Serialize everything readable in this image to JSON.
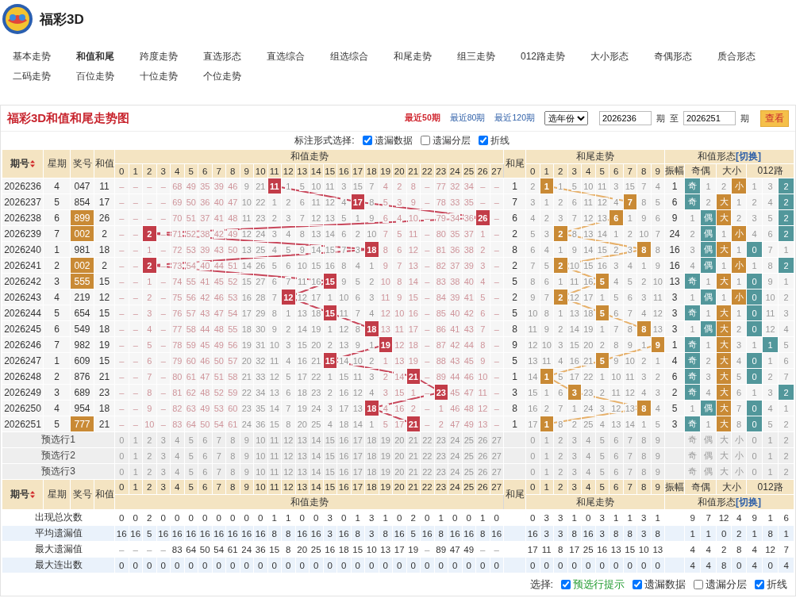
{
  "header": {
    "title": "福彩3D"
  },
  "nav": [
    {
      "label": "基本走势",
      "selected": false
    },
    {
      "label": "和值和尾",
      "selected": true
    },
    {
      "label": "跨度走势",
      "selected": false
    },
    {
      "label": "直选形态",
      "selected": false
    },
    {
      "label": "直选综合",
      "selected": false
    },
    {
      "label": "组选综合",
      "selected": false
    },
    {
      "label": "和尾走势",
      "selected": false
    },
    {
      "label": "组三走势",
      "selected": false
    },
    {
      "label": "012路走势",
      "selected": false
    },
    {
      "label": "大小形态",
      "selected": false
    },
    {
      "label": "奇偶形态",
      "selected": false
    },
    {
      "label": "质合形态",
      "selected": false
    },
    {
      "label": "二码走势",
      "selected": false
    },
    {
      "label": "百位走势",
      "selected": false
    },
    {
      "label": "十位走势",
      "selected": false
    },
    {
      "label": "个位走势",
      "selected": false
    }
  ],
  "panel": {
    "title": "福彩3D和值和尾走势图",
    "range_links": [
      {
        "label": "最近50期",
        "selected": true
      },
      {
        "label": "最近80期",
        "selected": false
      },
      {
        "label": "最近120期",
        "selected": false
      }
    ],
    "year_select": "选年份",
    "from": "2026236",
    "from_unit": "期",
    "to_label": "至",
    "to": "2026251",
    "to_unit": "期",
    "view_button": "查看"
  },
  "marking": {
    "label": "标注形式选择:",
    "options": [
      {
        "label": "遗漏数据",
        "checked": true
      },
      {
        "label": "遗漏分层",
        "checked": false
      },
      {
        "label": "折线",
        "checked": true
      }
    ]
  },
  "table": {
    "head": {
      "issue": "期号",
      "weekday": "星期",
      "draw": "奖号",
      "sum": "和值",
      "sum_trend": "和值走势",
      "sum_cols": [
        "0",
        "1",
        "2",
        "3",
        "4",
        "5",
        "6",
        "7",
        "8",
        "9",
        "10",
        "11",
        "12",
        "13",
        "14",
        "15",
        "16",
        "17",
        "18",
        "19",
        "20",
        "21",
        "22",
        "23",
        "24",
        "25",
        "26",
        "27"
      ],
      "tail": "和尾",
      "tail_trend": "和尾走势",
      "tail_cols": [
        "0",
        "1",
        "2",
        "3",
        "4",
        "5",
        "6",
        "7",
        "8",
        "9"
      ],
      "form": "和值形态",
      "switch": "[切换]",
      "amplitude": "振幅",
      "odd_even": "奇偶",
      "size": "大小",
      "mod3": "012路"
    },
    "rows": [
      {
        "issue": "2026236",
        "weekday": "4",
        "draw": "047",
        "draw_marked": false,
        "sum": "11",
        "sum_cells": [
          "–",
          "–",
          "–",
          "–",
          "68",
          "49",
          "35",
          "39",
          "46",
          "9",
          "21",
          {
            "text": "11",
            "hit": true
          },
          "1",
          "5",
          "10",
          "11",
          "3",
          "15",
          "7",
          "4",
          "2",
          "8",
          "–",
          "77",
          "32",
          "34",
          "–",
          "–"
        ],
        "tail": "1",
        "tail_cells": [
          "2",
          {
            "text": "1",
            "hit": true
          },
          "1",
          "5",
          "10",
          "11",
          "3",
          "15",
          "7",
          "4"
        ],
        "amplitude": "1",
        "form_cells": [
          {
            "text": "奇",
            "hit": true
          },
          "1",
          "2",
          {
            "text": "小",
            "hit": true
          },
          "1",
          "3",
          {
            "text": "2",
            "hit": true
          }
        ]
      },
      {
        "issue": "2026237",
        "weekday": "5",
        "draw": "854",
        "draw_marked": false,
        "sum": "17",
        "sum_cells": [
          "–",
          "–",
          "–",
          "–",
          "69",
          "50",
          "36",
          "40",
          "47",
          "10",
          "22",
          "1",
          "2",
          "6",
          "11",
          "12",
          "4",
          {
            "text": "17",
            "hit": true
          },
          "8",
          "5",
          "3",
          "9",
          "–",
          "78",
          "33",
          "35",
          "–",
          "–"
        ],
        "tail": "7",
        "tail_cells": [
          "3",
          "1",
          "2",
          "6",
          "11",
          "12",
          "4",
          {
            "text": "7",
            "hit": true
          },
          "8",
          "5"
        ],
        "amplitude": "6",
        "form_cells": [
          {
            "text": "奇",
            "hit": true
          },
          "2",
          {
            "text": "大",
            "hit": true
          },
          "1",
          "2",
          "4",
          {
            "text": "2",
            "hit": true
          }
        ]
      },
      {
        "issue": "2026238",
        "weekday": "6",
        "draw": "899",
        "draw_marked": true,
        "sum": "26",
        "sum_cells": [
          "–",
          "–",
          "–",
          "–",
          "70",
          "51",
          "37",
          "41",
          "48",
          "11",
          "23",
          "2",
          "3",
          "7",
          "12",
          "13",
          "5",
          "1",
          "9",
          "6",
          "4",
          "10",
          "–",
          "79",
          "34",
          "36",
          {
            "text": "26",
            "hit": true
          },
          "–"
        ],
        "tail": "6",
        "tail_cells": [
          "4",
          "2",
          "3",
          "7",
          "12",
          "13",
          {
            "text": "6",
            "hit": true
          },
          "1",
          "9",
          "6"
        ],
        "amplitude": "9",
        "form_cells": [
          "1",
          {
            "text": "偶",
            "hit": true
          },
          {
            "text": "大",
            "hit": true
          },
          "2",
          "3",
          "5",
          {
            "text": "2",
            "hit": true
          }
        ]
      },
      {
        "issue": "2026239",
        "weekday": "7",
        "draw": "002",
        "draw_marked": true,
        "sum": "2",
        "sum_cells": [
          "–",
          "–",
          {
            "text": "2",
            "hit": true
          },
          "–",
          "71",
          "52",
          "38",
          "42",
          "49",
          "12",
          "24",
          "3",
          "4",
          "8",
          "13",
          "14",
          "6",
          "2",
          "10",
          "7",
          "5",
          "11",
          "–",
          "80",
          "35",
          "37",
          "1",
          "–"
        ],
        "tail": "2",
        "tail_cells": [
          "5",
          "3",
          {
            "text": "2",
            "hit": true
          },
          "8",
          "13",
          "14",
          "1",
          "2",
          "10",
          "7"
        ],
        "amplitude": "24",
        "form_cells": [
          "2",
          {
            "text": "偶",
            "hit": true
          },
          "1",
          {
            "text": "小",
            "hit": true
          },
          "4",
          "6",
          {
            "text": "2",
            "hit": true
          }
        ]
      },
      {
        "issue": "2026240",
        "weekday": "1",
        "draw": "981",
        "draw_marked": false,
        "sum": "18",
        "sum_cells": [
          "–",
          "–",
          "1",
          "–",
          "72",
          "53",
          "39",
          "43",
          "50",
          "13",
          "25",
          "4",
          "5",
          "9",
          "14",
          "15",
          "7",
          "3",
          {
            "text": "18",
            "hit": true
          },
          "8",
          "6",
          "12",
          "–",
          "81",
          "36",
          "38",
          "2",
          "–"
        ],
        "tail": "8",
        "tail_cells": [
          "6",
          "4",
          "1",
          "9",
          "14",
          "15",
          "2",
          "3",
          {
            "text": "8",
            "hit": true
          },
          "8"
        ],
        "amplitude": "16",
        "form_cells": [
          "3",
          {
            "text": "偶",
            "hit": true
          },
          {
            "text": "大",
            "hit": true
          },
          "1",
          {
            "text": "0",
            "hit": true
          },
          "7",
          "1"
        ]
      },
      {
        "issue": "2026241",
        "weekday": "2",
        "draw": "002",
        "draw_marked": true,
        "sum": "2",
        "sum_cells": [
          "–",
          "–",
          {
            "text": "2",
            "hit": true
          },
          "–",
          "73",
          "54",
          "40",
          "44",
          "51",
          "14",
          "26",
          "5",
          "6",
          "10",
          "15",
          "16",
          "8",
          "4",
          "1",
          "9",
          "7",
          "13",
          "–",
          "82",
          "37",
          "39",
          "3",
          "–"
        ],
        "tail": "2",
        "tail_cells": [
          "7",
          "5",
          {
            "text": "2",
            "hit": true
          },
          "10",
          "15",
          "16",
          "3",
          "4",
          "1",
          "9"
        ],
        "amplitude": "16",
        "form_cells": [
          "4",
          {
            "text": "偶",
            "hit": true
          },
          "1",
          {
            "text": "小",
            "hit": true
          },
          "1",
          "8",
          {
            "text": "2",
            "hit": true
          }
        ]
      },
      {
        "issue": "2026242",
        "weekday": "3",
        "draw": "555",
        "draw_marked": true,
        "sum": "15",
        "sum_cells": [
          "–",
          "–",
          "1",
          "–",
          "74",
          "55",
          "41",
          "45",
          "52",
          "15",
          "27",
          "6",
          "7",
          "11",
          "16",
          {
            "text": "15",
            "hit": true
          },
          "9",
          "5",
          "2",
          "10",
          "8",
          "14",
          "–",
          "83",
          "38",
          "40",
          "4",
          "–"
        ],
        "tail": "5",
        "tail_cells": [
          "8",
          "6",
          "1",
          "11",
          "16",
          {
            "text": "5",
            "hit": true
          },
          "4",
          "5",
          "2",
          "10"
        ],
        "amplitude": "13",
        "form_cells": [
          {
            "text": "奇",
            "hit": true
          },
          "1",
          {
            "text": "大",
            "hit": true
          },
          "1",
          {
            "text": "0",
            "hit": true
          },
          "9",
          "1"
        ]
      },
      {
        "issue": "2026243",
        "weekday": "4",
        "draw": "219",
        "draw_marked": false,
        "sum": "12",
        "sum_cells": [
          "–",
          "–",
          "2",
          "–",
          "75",
          "56",
          "42",
          "46",
          "53",
          "16",
          "28",
          "7",
          {
            "text": "12",
            "hit": true
          },
          "12",
          "17",
          "1",
          "10",
          "6",
          "3",
          "11",
          "9",
          "15",
          "–",
          "84",
          "39",
          "41",
          "5",
          "–"
        ],
        "tail": "2",
        "tail_cells": [
          "9",
          "7",
          {
            "text": "2",
            "hit": true
          },
          "12",
          "17",
          "1",
          "5",
          "6",
          "3",
          "11"
        ],
        "amplitude": "3",
        "form_cells": [
          "1",
          {
            "text": "偶",
            "hit": true
          },
          "1",
          {
            "text": "小",
            "hit": true
          },
          {
            "text": "0",
            "hit": true
          },
          "10",
          "2"
        ]
      },
      {
        "issue": "2026244",
        "weekday": "5",
        "draw": "654",
        "draw_marked": false,
        "sum": "15",
        "sum_cells": [
          "–",
          "–",
          "3",
          "–",
          "76",
          "57",
          "43",
          "47",
          "54",
          "17",
          "29",
          "8",
          "1",
          "13",
          "18",
          {
            "text": "15",
            "hit": true
          },
          "11",
          "7",
          "4",
          "12",
          "10",
          "16",
          "–",
          "85",
          "40",
          "42",
          "6",
          "–"
        ],
        "tail": "5",
        "tail_cells": [
          "10",
          "8",
          "1",
          "13",
          "18",
          {
            "text": "5",
            "hit": true
          },
          "6",
          "7",
          "4",
          "12"
        ],
        "amplitude": "3",
        "form_cells": [
          {
            "text": "奇",
            "hit": true
          },
          "1",
          {
            "text": "大",
            "hit": true
          },
          "1",
          {
            "text": "0",
            "hit": true
          },
          "11",
          "3"
        ]
      },
      {
        "issue": "2026245",
        "weekday": "6",
        "draw": "549",
        "draw_marked": false,
        "sum": "18",
        "sum_cells": [
          "–",
          "–",
          "4",
          "–",
          "77",
          "58",
          "44",
          "48",
          "55",
          "18",
          "30",
          "9",
          "2",
          "14",
          "19",
          "1",
          "12",
          "8",
          {
            "text": "18",
            "hit": true
          },
          "13",
          "11",
          "17",
          "–",
          "86",
          "41",
          "43",
          "7",
          "–"
        ],
        "tail": "8",
        "tail_cells": [
          "11",
          "9",
          "2",
          "14",
          "19",
          "1",
          "7",
          "8",
          {
            "text": "8",
            "hit": true
          },
          "13"
        ],
        "amplitude": "3",
        "form_cells": [
          "1",
          {
            "text": "偶",
            "hit": true
          },
          {
            "text": "大",
            "hit": true
          },
          "2",
          {
            "text": "0",
            "hit": true
          },
          "12",
          "4"
        ]
      },
      {
        "issue": "2026246",
        "weekday": "7",
        "draw": "982",
        "draw_marked": false,
        "sum": "19",
        "sum_cells": [
          "–",
          "–",
          "5",
          "–",
          "78",
          "59",
          "45",
          "49",
          "56",
          "19",
          "31",
          "10",
          "3",
          "15",
          "20",
          "2",
          "13",
          "9",
          "1",
          {
            "text": "19",
            "hit": true
          },
          "12",
          "18",
          "–",
          "87",
          "42",
          "44",
          "8",
          "–"
        ],
        "tail": "9",
        "tail_cells": [
          "12",
          "10",
          "3",
          "15",
          "20",
          "2",
          "8",
          "9",
          "1",
          {
            "text": "9",
            "hit": true
          }
        ],
        "amplitude": "1",
        "form_cells": [
          {
            "text": "奇",
            "hit": true
          },
          "1",
          {
            "text": "大",
            "hit": true
          },
          "3",
          "1",
          {
            "text": "1",
            "hit": true
          },
          "5"
        ]
      },
      {
        "issue": "2026247",
        "weekday": "1",
        "draw": "609",
        "draw_marked": false,
        "sum": "15",
        "sum_cells": [
          "–",
          "–",
          "6",
          "–",
          "79",
          "60",
          "46",
          "50",
          "57",
          "20",
          "32",
          "11",
          "4",
          "16",
          "21",
          {
            "text": "15",
            "hit": true
          },
          "14",
          "10",
          "2",
          "1",
          "13",
          "19",
          "–",
          "88",
          "43",
          "45",
          "9",
          "–"
        ],
        "tail": "5",
        "tail_cells": [
          "13",
          "11",
          "4",
          "16",
          "21",
          {
            "text": "5",
            "hit": true
          },
          "9",
          "10",
          "2",
          "1"
        ],
        "amplitude": "4",
        "form_cells": [
          {
            "text": "奇",
            "hit": true
          },
          "2",
          {
            "text": "大",
            "hit": true
          },
          "4",
          {
            "text": "0",
            "hit": true
          },
          "1",
          "6"
        ]
      },
      {
        "issue": "2026248",
        "weekday": "2",
        "draw": "876",
        "draw_marked": false,
        "sum": "21",
        "sum_cells": [
          "–",
          "–",
          "7",
          "–",
          "80",
          "61",
          "47",
          "51",
          "58",
          "21",
          "33",
          "12",
          "5",
          "17",
          "22",
          "1",
          "15",
          "11",
          "3",
          "2",
          "14",
          {
            "text": "21",
            "hit": true
          },
          "–",
          "89",
          "44",
          "46",
          "10",
          "–"
        ],
        "tail": "1",
        "tail_cells": [
          "14",
          {
            "text": "1",
            "hit": true
          },
          "5",
          "17",
          "22",
          "1",
          "10",
          "11",
          "3",
          "2"
        ],
        "amplitude": "6",
        "form_cells": [
          {
            "text": "奇",
            "hit": true
          },
          "3",
          {
            "text": "大",
            "hit": true
          },
          "5",
          {
            "text": "0",
            "hit": true
          },
          "2",
          "7"
        ]
      },
      {
        "issue": "2026249",
        "weekday": "3",
        "draw": "689",
        "draw_marked": false,
        "sum": "23",
        "sum_cells": [
          "–",
          "–",
          "8",
          "–",
          "81",
          "62",
          "48",
          "52",
          "59",
          "22",
          "34",
          "13",
          "6",
          "18",
          "23",
          "2",
          "16",
          "12",
          "4",
          "3",
          "15",
          "1",
          "–",
          {
            "text": "23",
            "hit": true
          },
          "45",
          "47",
          "11",
          "–"
        ],
        "tail": "3",
        "tail_cells": [
          "15",
          "1",
          "6",
          {
            "text": "3",
            "hit": true
          },
          "23",
          "2",
          "11",
          "12",
          "4",
          "3"
        ],
        "amplitude": "2",
        "form_cells": [
          {
            "text": "奇",
            "hit": true
          },
          "4",
          {
            "text": "大",
            "hit": true
          },
          "6",
          "1",
          "3",
          {
            "text": "2",
            "hit": true
          }
        ]
      },
      {
        "issue": "2026250",
        "weekday": "4",
        "draw": "954",
        "draw_marked": false,
        "sum": "18",
        "sum_cells": [
          "–",
          "–",
          "9",
          "–",
          "82",
          "63",
          "49",
          "53",
          "60",
          "23",
          "35",
          "14",
          "7",
          "19",
          "24",
          "3",
          "17",
          "13",
          {
            "text": "18",
            "hit": true
          },
          "4",
          "16",
          "2",
          "–",
          "1",
          "46",
          "48",
          "12",
          "–"
        ],
        "tail": "8",
        "tail_cells": [
          "16",
          "2",
          "7",
          "1",
          "24",
          "3",
          "12",
          "13",
          {
            "text": "8",
            "hit": true
          },
          "4"
        ],
        "amplitude": "5",
        "form_cells": [
          "1",
          {
            "text": "偶",
            "hit": true
          },
          {
            "text": "大",
            "hit": true
          },
          "7",
          {
            "text": "0",
            "hit": true
          },
          "4",
          "1"
        ]
      },
      {
        "issue": "2026251",
        "weekday": "5",
        "draw": "777",
        "draw_marked": true,
        "sum": "21",
        "sum_cells": [
          "–",
          "–",
          "10",
          "–",
          "83",
          "64",
          "50",
          "54",
          "61",
          "24",
          "36",
          "15",
          "8",
          "20",
          "25",
          "4",
          "18",
          "14",
          "1",
          "5",
          "17",
          {
            "text": "21",
            "hit": true
          },
          "–",
          "2",
          "47",
          "49",
          "13",
          "–"
        ],
        "tail": "1",
        "tail_cells": [
          "17",
          {
            "text": "1",
            "hit": true
          },
          "8",
          "2",
          "25",
          "4",
          "13",
          "14",
          "1",
          "5"
        ],
        "amplitude": "3",
        "form_cells": [
          {
            "text": "奇",
            "hit": true
          },
          "1",
          {
            "text": "大",
            "hit": true
          },
          "8",
          {
            "text": "0",
            "hit": true
          },
          "5",
          "2"
        ]
      }
    ],
    "preselect_rows": [
      {
        "label": "预选行1",
        "sum_cells": [
          "0",
          "1",
          "2",
          "3",
          "4",
          "5",
          "6",
          "7",
          "8",
          "9",
          "10",
          "11",
          "12",
          "13",
          "14",
          "15",
          "16",
          "17",
          "18",
          "19",
          "20",
          "21",
          "22",
          "23",
          "24",
          "25",
          "26",
          "27"
        ],
        "tail_cells": [
          "0",
          "1",
          "2",
          "3",
          "4",
          "5",
          "6",
          "7",
          "8",
          "9"
        ],
        "form_cells": [
          "奇",
          "偶",
          "大",
          "小",
          "0",
          "1",
          "2"
        ]
      },
      {
        "label": "预选行2",
        "sum_cells": [
          "0",
          "1",
          "2",
          "3",
          "4",
          "5",
          "6",
          "7",
          "8",
          "9",
          "10",
          "11",
          "12",
          "13",
          "14",
          "15",
          "16",
          "17",
          "18",
          "19",
          "20",
          "21",
          "22",
          "23",
          "24",
          "25",
          "26",
          "27"
        ],
        "tail_cells": [
          "0",
          "1",
          "2",
          "3",
          "4",
          "5",
          "6",
          "7",
          "8",
          "9"
        ],
        "form_cells": [
          "奇",
          "偶",
          "大",
          "小",
          "0",
          "1",
          "2"
        ]
      },
      {
        "label": "预选行3",
        "sum_cells": [
          "0",
          "1",
          "2",
          "3",
          "4",
          "5",
          "6",
          "7",
          "8",
          "9",
          "10",
          "11",
          "12",
          "13",
          "14",
          "15",
          "16",
          "17",
          "18",
          "19",
          "20",
          "21",
          "22",
          "23",
          "24",
          "25",
          "26",
          "27"
        ],
        "tail_cells": [
          "0",
          "1",
          "2",
          "3",
          "4",
          "5",
          "6",
          "7",
          "8",
          "9"
        ],
        "form_cells": [
          "奇",
          "偶",
          "大",
          "小",
          "0",
          "1",
          "2"
        ]
      }
    ],
    "foot_head": {
      "issue": "期号",
      "weekday": "星期",
      "draw": "奖号",
      "sum": "和值",
      "sum_trend": "和值走势",
      "sum_cols": [
        "0",
        "1",
        "2",
        "3",
        "4",
        "5",
        "6",
        "7",
        "8",
        "9",
        "10",
        "11",
        "12",
        "13",
        "14",
        "15",
        "16",
        "17",
        "18",
        "19",
        "20",
        "21",
        "22",
        "23",
        "24",
        "25",
        "26",
        "27"
      ],
      "tail": "和尾",
      "tail_trend": "和尾走势",
      "tail_cols": [
        "0",
        "1",
        "2",
        "3",
        "4",
        "5",
        "6",
        "7",
        "8",
        "9"
      ],
      "form": "和值形态",
      "switch": "[切换]",
      "amplitude": "振幅",
      "odd_even": "奇偶",
      "size": "大小",
      "mod3": "012路"
    },
    "stats": [
      {
        "label": "出现总次数",
        "sum_cells": [
          "0",
          "0",
          "2",
          "0",
          "0",
          "0",
          "0",
          "0",
          "0",
          "0",
          "0",
          "1",
          "1",
          "0",
          "0",
          "3",
          "0",
          "1",
          "3",
          "1",
          "0",
          "2",
          "0",
          "1",
          "0",
          "0",
          "1",
          "0"
        ],
        "tail_cells": [
          "0",
          "3",
          "3",
          "1",
          "0",
          "3",
          "1",
          "1",
          "3",
          "1"
        ],
        "form_cells": [
          "9",
          "7",
          "12",
          "4",
          "9",
          "1",
          "6"
        ]
      },
      {
        "label": "平均遗漏值",
        "sum_cells": [
          "16",
          "16",
          "5",
          "16",
          "16",
          "16",
          "16",
          "16",
          "16",
          "16",
          "16",
          "8",
          "8",
          "16",
          "16",
          "3",
          "16",
          "8",
          "3",
          "8",
          "16",
          "5",
          "16",
          "8",
          "16",
          "16",
          "8",
          "16"
        ],
        "tail_cells": [
          "16",
          "3",
          "3",
          "8",
          "16",
          "3",
          "8",
          "8",
          "3",
          "8"
        ],
        "form_cells": [
          "1",
          "1",
          "0",
          "2",
          "1",
          "8",
          "1"
        ]
      },
      {
        "label": "最大遗漏值",
        "sum_cells": [
          "–",
          "–",
          "–",
          "–",
          "83",
          "64",
          "50",
          "54",
          "61",
          "24",
          "36",
          "15",
          "8",
          "20",
          "25",
          "16",
          "18",
          "15",
          "10",
          "13",
          "17",
          "19",
          "–",
          "89",
          "47",
          "49",
          "–",
          "–"
        ],
        "tail_cells": [
          "17",
          "11",
          "8",
          "17",
          "25",
          "16",
          "13",
          "15",
          "10",
          "13"
        ],
        "form_cells": [
          "4",
          "4",
          "2",
          "8",
          "4",
          "12",
          "7"
        ]
      },
      {
        "label": "最大连出数",
        "sum_cells": [
          "0",
          "0",
          "0",
          "0",
          "0",
          "0",
          "0",
          "0",
          "0",
          "0",
          "0",
          "0",
          "0",
          "0",
          "0",
          "0",
          "0",
          "0",
          "0",
          "0",
          "0",
          "0",
          "0",
          "0",
          "0",
          "0",
          "0",
          "0"
        ],
        "tail_cells": [
          "0",
          "0",
          "0",
          "0",
          "0",
          "0",
          "0",
          "0",
          "0",
          "0"
        ],
        "form_cells": [
          "4",
          "4",
          "8",
          "0",
          "4",
          "0",
          "4"
        ]
      }
    ]
  },
  "footer": {
    "label": "选择:",
    "options": [
      {
        "label": "预选行提示",
        "checked": true,
        "kind": "hint"
      },
      {
        "label": "遗漏数据",
        "checked": true,
        "kind": "plain"
      },
      {
        "label": "遗漏分层",
        "checked": false,
        "kind": "plain"
      },
      {
        "label": "折线",
        "checked": true,
        "kind": "plain"
      }
    ]
  }
}
